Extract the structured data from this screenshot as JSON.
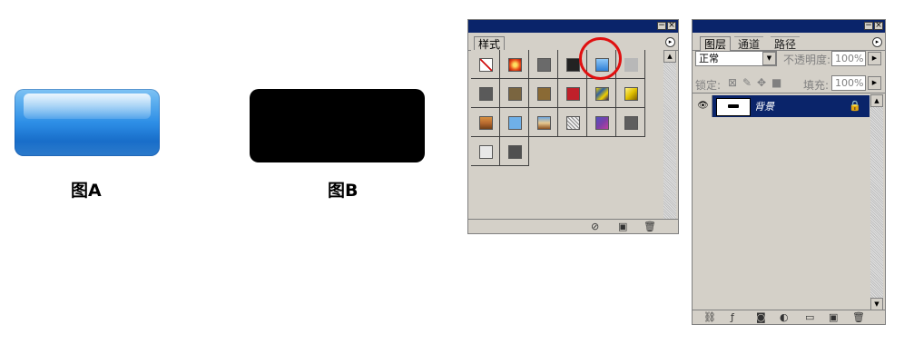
{
  "figures": {
    "a_caption": "图A",
    "b_caption": "图B"
  },
  "styles_panel": {
    "tab_label": "样式",
    "swatches": [
      {
        "name": "no-style",
        "color": "#ffffff"
      },
      {
        "name": "orange-glow",
        "color": "#e8501a"
      },
      {
        "name": "dark-gray",
        "color": "#6a6a6a"
      },
      {
        "name": "chrome-black",
        "color": "#222222"
      },
      {
        "name": "blue-glass",
        "color": "#2e7fd6"
      },
      {
        "name": "empty-gray",
        "color": "#b8b8b8"
      },
      {
        "name": "gray-bevel",
        "color": "#5a5a5a"
      },
      {
        "name": "brown",
        "color": "#7a6540"
      },
      {
        "name": "brown-gradient",
        "color": "#8a6a35"
      },
      {
        "name": "red",
        "color": "#c0202a"
      },
      {
        "name": "rainbow",
        "color": "#3060a0"
      },
      {
        "name": "gold",
        "color": "#e0c000"
      },
      {
        "name": "copper",
        "color": "#b86a30"
      },
      {
        "name": "light-blue",
        "color": "#6fb0e8"
      },
      {
        "name": "sunset",
        "color": "#4a7fb8"
      },
      {
        "name": "noise",
        "color": "#c8c8c8"
      },
      {
        "name": "purple",
        "color": "#7a40a8"
      },
      {
        "name": "medium-gray",
        "color": "#5e5e5e"
      },
      {
        "name": "outline",
        "color": "#d4d0c8"
      },
      {
        "name": "charcoal",
        "color": "#505050"
      }
    ]
  },
  "layers_panel": {
    "tabs": [
      "图层",
      "通道",
      "路径"
    ],
    "blend_mode": "正常",
    "opacity_label": "不透明度:",
    "opacity_value": "100%",
    "lock_label": "锁定:",
    "fill_label": "填充:",
    "fill_value": "100%",
    "layer_name": "背景"
  },
  "colors": {
    "titlebar": "#0a246a",
    "panel_bg": "#d4d0c8",
    "highlight_circle": "#e01010",
    "selected_row": "#0a246a"
  }
}
